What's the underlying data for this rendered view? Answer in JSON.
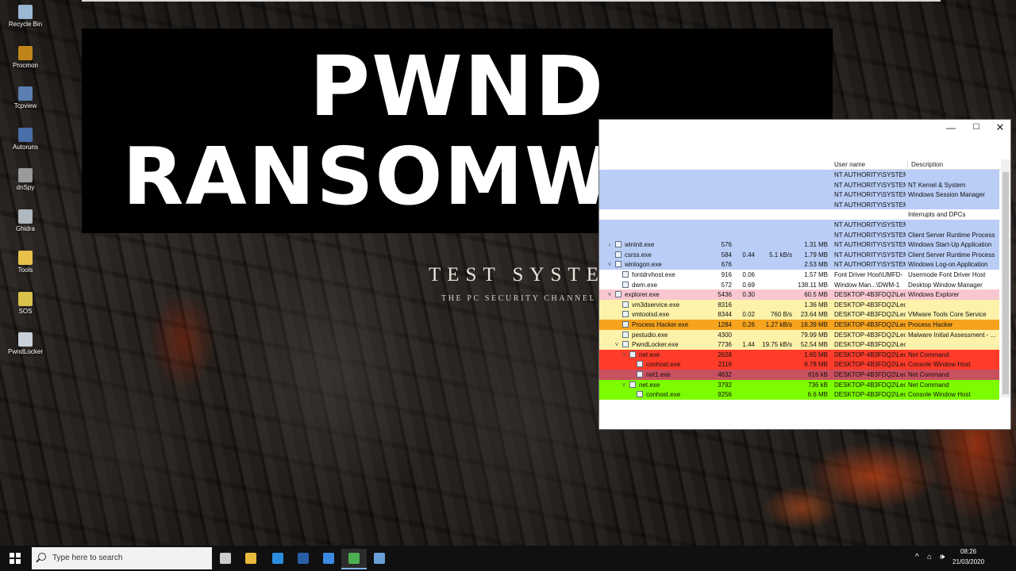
{
  "desktop_icons": [
    {
      "label": "Recycle Bin",
      "icon": "recycle-bin-icon",
      "color": "#9bb8d3"
    },
    {
      "label": "Procmon",
      "icon": "procmon-icon",
      "color": "#c0841a"
    },
    {
      "label": "Tcpview",
      "icon": "tcpview-icon",
      "color": "#5b7fb0"
    },
    {
      "label": "Autoruns",
      "icon": "autoruns-icon",
      "color": "#4a6ea8"
    },
    {
      "label": "dnSpy",
      "icon": "dnspy-icon",
      "color": "#9a9a9a"
    },
    {
      "label": "Ghidra",
      "icon": "ghidra-icon",
      "color": "#b0b8c0"
    },
    {
      "label": "Tools",
      "icon": "folder-icon",
      "color": "#e8c14a"
    },
    {
      "label": "SOS",
      "icon": "sos-icon",
      "color": "#d9c04a"
    },
    {
      "label": "PwndLocker",
      "icon": "pwndlocker-icon",
      "color": "#c8d0da"
    }
  ],
  "banner": {
    "line1": "PWND",
    "line2": "RANSOMWARE"
  },
  "wallpaper": {
    "title": "TEST SYSTEM",
    "subtitle": "THE PC SECURITY CHANNEL"
  },
  "process_window": {
    "controls": {
      "minimize": "—",
      "maximize": "☐",
      "close": "✕"
    },
    "columns": {
      "user": "User name",
      "desc": "Description"
    },
    "rows": [
      {
        "indent": 0,
        "expander": "",
        "name": "",
        "pid": "",
        "cpu": "",
        "io": "",
        "mem": "",
        "user": "NT AUTHORITY\\SYSTEM",
        "desc": "",
        "bg": "#b9cdf6"
      },
      {
        "indent": 0,
        "expander": "",
        "name": "",
        "pid": "",
        "cpu": "",
        "io": "",
        "mem": "",
        "user": "NT AUTHORITY\\SYSTEM",
        "desc": "NT Kernel & System",
        "bg": "#b9cdf6"
      },
      {
        "indent": 0,
        "expander": "",
        "name": "",
        "pid": "",
        "cpu": "",
        "io": "",
        "mem": "",
        "user": "NT AUTHORITY\\SYSTEM",
        "desc": "Windows Session Manager",
        "bg": "#b9cdf6"
      },
      {
        "indent": 0,
        "expander": "",
        "name": "",
        "pid": "",
        "cpu": "",
        "io": "",
        "mem": "",
        "user": "NT AUTHORITY\\SYSTEM",
        "desc": "",
        "bg": "#b9cdf6"
      },
      {
        "indent": 0,
        "expander": "",
        "name": "",
        "pid": "",
        "cpu": "",
        "io": "",
        "mem": "",
        "user": "",
        "desc": "Interrupts and DPCs",
        "bg": "#ffffff"
      },
      {
        "indent": 0,
        "expander": "",
        "name": "",
        "pid": "",
        "cpu": "",
        "io": "",
        "mem": "",
        "user": "NT AUTHORITY\\SYSTEM",
        "desc": "",
        "bg": "#b9cdf6"
      },
      {
        "indent": 0,
        "expander": "",
        "name": "",
        "pid": "",
        "cpu": "",
        "io": "",
        "mem": "",
        "user": "NT AUTHORITY\\SYSTEM",
        "desc": "Client Server Runtime Process",
        "bg": "#b9cdf6"
      },
      {
        "indent": 0,
        "expander": "›",
        "name": "wininit.exe",
        "pid": "576",
        "cpu": "",
        "io": "",
        "mem": "1.31 MB",
        "user": "NT AUTHORITY\\SYSTEM",
        "desc": "Windows Start-Up Application",
        "bg": "#b9cdf6"
      },
      {
        "indent": 0,
        "expander": "",
        "name": "csrss.exe",
        "pid": "584",
        "cpu": "0.44",
        "io": "5.1 kB/s",
        "mem": "1.79 MB",
        "user": "NT AUTHORITY\\SYSTEM",
        "desc": "Client Server Runtime Process",
        "bg": "#b9cdf6"
      },
      {
        "indent": 0,
        "expander": "˅",
        "name": "winlogon.exe",
        "pid": "676",
        "cpu": "",
        "io": "",
        "mem": "2.53 MB",
        "user": "NT AUTHORITY\\SYSTEM",
        "desc": "Windows Log-on Application",
        "bg": "#b9cdf6"
      },
      {
        "indent": 1,
        "expander": "",
        "name": "fontdrvhost.exe",
        "pid": "916",
        "cpu": "0.06",
        "io": "",
        "mem": "1.57 MB",
        "user": "Font Driver Host\\UMFD-",
        "desc": "Usermode Font Driver Host",
        "bg": "#ffffff"
      },
      {
        "indent": 1,
        "expander": "",
        "name": "dwm.exe",
        "pid": "572",
        "cpu": "0.69",
        "io": "",
        "mem": "138.11 MB",
        "user": "Window Man...\\DWM-1",
        "desc": "Desktop Window Manager",
        "bg": "#ffffff"
      },
      {
        "indent": 0,
        "expander": "˅",
        "name": "explorer.exe",
        "pid": "5436",
        "cpu": "0.30",
        "io": "",
        "mem": "60.5 MB",
        "user": "DESKTOP-4B3FDQ2\\Leo",
        "desc": "Windows Explorer",
        "bg": "#f8c7cf"
      },
      {
        "indent": 1,
        "expander": "",
        "name": "vm3dservice.exe",
        "pid": "8316",
        "cpu": "",
        "io": "",
        "mem": "1.36 MB",
        "user": "DESKTOP-4B3FDQ2\\Leo",
        "desc": "",
        "bg": "#fdf2a9"
      },
      {
        "indent": 1,
        "expander": "",
        "name": "vmtoolsd.exe",
        "pid": "8344",
        "cpu": "0.02",
        "io": "760 B/s",
        "mem": "23.64 MB",
        "user": "DESKTOP-4B3FDQ2\\Leo",
        "desc": "VMware Tools Core Service",
        "bg": "#fdf2a9"
      },
      {
        "indent": 1,
        "expander": "",
        "name": "Process Hacker.exe",
        "pid": "1284",
        "cpu": "0.26",
        "io": "1.27 kB/s",
        "mem": "18.39 MB",
        "user": "DESKTOP-4B3FDQ2\\Leo",
        "desc": "Process Hacker",
        "bg": "#f6a31e"
      },
      {
        "indent": 1,
        "expander": "",
        "name": "pestudio.exe",
        "pid": "4300",
        "cpu": "",
        "io": "",
        "mem": "79.99 MB",
        "user": "DESKTOP-4B3FDQ2\\Leo",
        "desc": "Malware Initial Assessment - ...",
        "bg": "#fdf2a9"
      },
      {
        "indent": 1,
        "expander": "˅",
        "name": "PwndLocker.exe",
        "pid": "7736",
        "cpu": "1.44",
        "io": "19.75 kB/s",
        "mem": "52.54 MB",
        "user": "DESKTOP-4B3FDQ2\\Leo",
        "desc": "",
        "bg": "#fdf2a9"
      },
      {
        "indent": 2,
        "expander": "˅",
        "name": "net.exe",
        "pid": "2628",
        "cpu": "",
        "io": "",
        "mem": "1.65 MB",
        "user": "DESKTOP-4B3FDQ2\\Leo",
        "desc": "Net Command",
        "bg": "#ff3b2a"
      },
      {
        "indent": 3,
        "expander": "",
        "name": "conhost.exe",
        "pid": "2116",
        "cpu": "",
        "io": "",
        "mem": "6.78 MB",
        "user": "DESKTOP-4B3FDQ2\\Leo",
        "desc": "Console Window Host",
        "bg": "#ff3b2a"
      },
      {
        "indent": 3,
        "expander": "",
        "name": "net1.exe",
        "pid": "4632",
        "cpu": "",
        "io": "",
        "mem": "616 kB",
        "user": "DESKTOP-4B3FDQ2\\Leo",
        "desc": "Net Command",
        "bg": "#c8505f"
      },
      {
        "indent": 2,
        "expander": "˅",
        "name": "net.exe",
        "pid": "3792",
        "cpu": "",
        "io": "",
        "mem": "736 kB",
        "user": "DESKTOP-4B3FDQ2\\Leo",
        "desc": "Net Command",
        "bg": "#7dfc00"
      },
      {
        "indent": 3,
        "expander": "",
        "name": "conhost.exe",
        "pid": "9256",
        "cpu": "",
        "io": "",
        "mem": "6.6 MB",
        "user": "DESKTOP-4B3FDQ2\\Leo",
        "desc": "Console Window Host",
        "bg": "#7dfc00"
      }
    ]
  },
  "taskbar": {
    "search_placeholder": "Type here to search",
    "apps": [
      {
        "icon": "task-view-icon",
        "color": "#cccccc"
      },
      {
        "icon": "file-explorer-icon",
        "color": "#e8b93a"
      },
      {
        "icon": "edge-icon",
        "color": "#2b8de0"
      },
      {
        "icon": "powershell-icon",
        "color": "#2a5ea8"
      },
      {
        "icon": "checklist-icon",
        "color": "#3c8ae0"
      },
      {
        "icon": "process-hacker-icon",
        "color": "#4caf50"
      },
      {
        "icon": "network-app-icon",
        "color": "#6aa0d8"
      }
    ],
    "tray": {
      "chevron": "^",
      "network": "⌂",
      "volume": "🕪"
    },
    "clock_time": "08:26",
    "clock_date": "21/03/2020"
  }
}
